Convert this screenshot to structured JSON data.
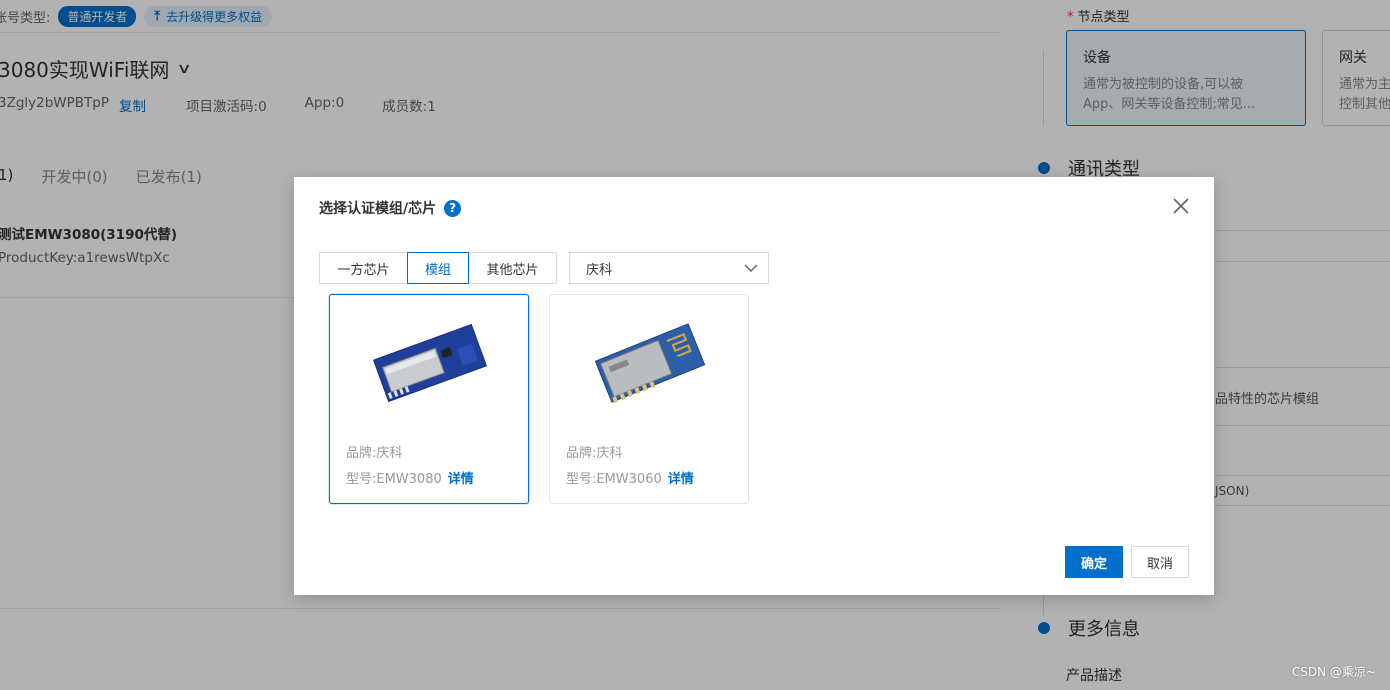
{
  "background": {
    "account_type_label": "账号类型:",
    "account_badge": "普通开发者",
    "upgrade_label": "去升级得更多权益",
    "project_title": "3080实现WiFi联网",
    "project_id": "3Zgly2bWPBTpP",
    "copy_label": "复制",
    "activation_code": "项目激活码:0",
    "app_count": "App:0",
    "member_count": "成员数:1",
    "tabs": [
      "1)",
      "开发中(0)",
      "已发布(1)"
    ],
    "product_name": "测试EMW3080(3190代替)",
    "product_key": "ProductKey:a1rewsWtpXc"
  },
  "drawer": {
    "node_type_label": "节点类型",
    "node_cards": [
      {
        "title": "设备",
        "desc1": "通常为被控制的设备,可以被",
        "desc2": "App、网关等设备控制;常见..."
      },
      {
        "title": "网关",
        "desc1": "通常为主",
        "desc2": "控制其他"
      }
    ],
    "section_comm": "通讯类型",
    "chip_hint": "品特性的芯片模组",
    "json_hint": "JSON)",
    "section_more": "更多信息",
    "product_desc_label": "产品描述"
  },
  "dialog": {
    "title": "选择认证模组/芯片",
    "help_glyph": "?",
    "segments": [
      "一方芯片",
      "模组",
      "其他芯片"
    ],
    "active_segment": "模组",
    "brand_select_value": "庆科",
    "modules": [
      {
        "brand": "品牌:庆科",
        "model": "型号:EMW3080",
        "detail": "详情",
        "selected": true
      },
      {
        "brand": "品牌:庆科",
        "model": "型号:EMW3060",
        "detail": "详情",
        "selected": false
      }
    ],
    "ok_label": "确定",
    "cancel_label": "取消"
  },
  "watermark": "CSDN @乘凉~",
  "colors": {
    "accent": "#0070cc",
    "overlay": "rgba(0,0,0,0.30)"
  }
}
